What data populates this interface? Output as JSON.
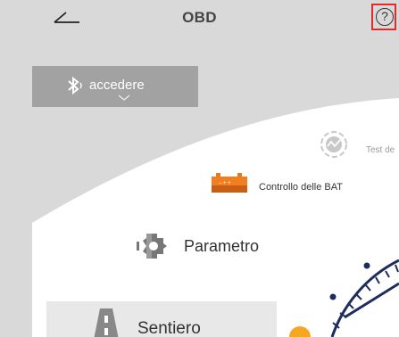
{
  "header": {
    "title": "OBD",
    "help_symbol": "?",
    "back_icon": "back-arrow-icon",
    "help_icon": "help-circle-icon"
  },
  "connect": {
    "label": "accedere",
    "icon": "bluetooth-icon"
  },
  "menu": {
    "items": [
      {
        "label": "Test de",
        "icon": "test-gear-icon"
      },
      {
        "label": "Controllo delle BAT",
        "icon": "battery-icon"
      },
      {
        "label": "Parametro",
        "icon": "parameter-gear-icon"
      },
      {
        "label": "Sentiero",
        "icon": "road-icon"
      }
    ]
  },
  "colors": {
    "background": "#d9d9d9",
    "panel": "#ffffff",
    "connect_button": "#a2a2a2",
    "accent_orange": "#f5a623",
    "dial_blue": "#1f2d5c",
    "highlight_border": "#e32a2a"
  }
}
